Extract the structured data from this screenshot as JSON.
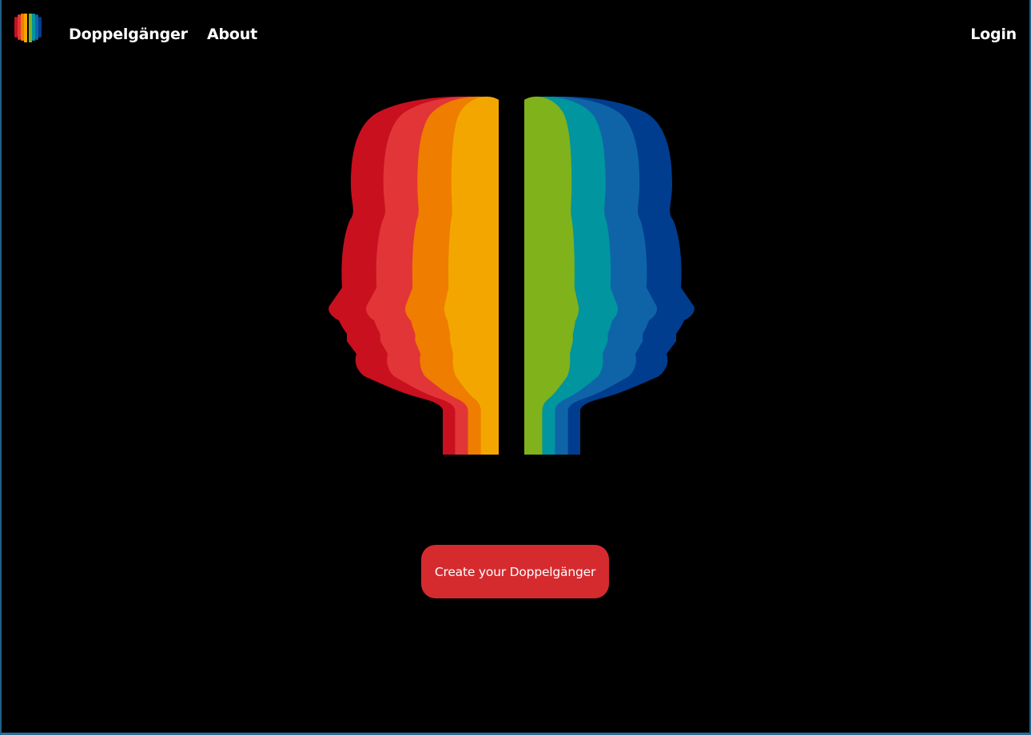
{
  "nav": {
    "brand_label": "Doppelgänger",
    "about_label": "About",
    "login_label": "Login",
    "logo_icon": "rainbow-faces-logo-icon"
  },
  "hero": {
    "illustration_icon": "rainbow-double-profile-icon",
    "colors_left": [
      "#c8101f",
      "#e23537",
      "#ee7d00",
      "#f4a600"
    ],
    "colors_right": [
      "#80b21b",
      "#00959f",
      "#0f64a8",
      "#003d8f"
    ]
  },
  "cta": {
    "label": "Create your Doppelgänger",
    "color": "#d52b2f"
  },
  "background_color": "#000000"
}
